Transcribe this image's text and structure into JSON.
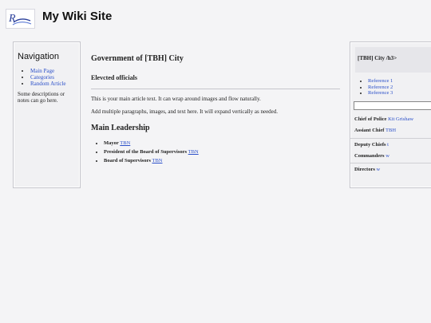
{
  "site": {
    "title": "My Wiki Site"
  },
  "nav": {
    "heading": "Navigation",
    "links": [
      "Main Page",
      "Categories",
      "Random Article"
    ],
    "note": "Some descriptions or notes can go here."
  },
  "article": {
    "title": "Government of [TBH] City",
    "subtitle": "Elevcted officials",
    "paragraphs": [
      "This is your main article text. It can wrap around images and flow naturally.",
      "Add multiple paragraphs, images, and text here. It will expand vertically as needed."
    ],
    "section_title": "Main Leadership",
    "leaders": [
      {
        "role": "Mayor",
        "name": "TBN"
      },
      {
        "role": "President of the Board of Supervisors",
        "name": "TBN"
      },
      {
        "role": "Board of Supervisors",
        "name": "TBN"
      }
    ]
  },
  "sidebar": {
    "heading": "[TBH] City /h3>",
    "references": [
      "Reference 1",
      "Reference 2",
      "Reference 3"
    ],
    "search_value": "",
    "chief": {
      "label": "Chief of Police",
      "value": "Kit Grishaw"
    },
    "assistant": {
      "label": "Assiant Chief",
      "value": "TBH"
    },
    "deputy": {
      "label": "Deputy Chiefs",
      "value": "t"
    },
    "commanders": {
      "label": "Commanders",
      "value": "w"
    },
    "directors": {
      "label": "Directors",
      "value": "w"
    }
  }
}
